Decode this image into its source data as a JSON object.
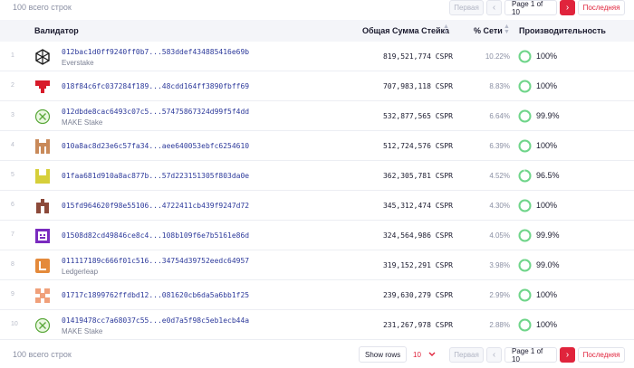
{
  "summary": "100 всего строк",
  "pagination": {
    "first": "Первая",
    "prev": "‹",
    "info": "Page 1 of 10",
    "next": "›",
    "last": "Последняя"
  },
  "footer": {
    "summary": "100 всего строк",
    "show_rows": "Show rows",
    "rows_per_page": "10"
  },
  "table": {
    "columns": {
      "validator": "Валидатор",
      "stake": "Общая Сумма Стейка",
      "share": "% Сети",
      "performance": "Производительность"
    },
    "rows": [
      {
        "index": "1",
        "address": "012bac1d0ff9240ff0b7...583ddef434885416e69b",
        "name": "Everstake",
        "stake": "819,521,774 CSPR",
        "share": "10.22%",
        "performance": "100%",
        "logo": "everstake-icon",
        "perf_value": 1.0
      },
      {
        "index": "2",
        "address": "018f84c6fc037284f189...48cdd164ff3890fbff69",
        "name": "",
        "stake": "707,983,118 CSPR",
        "share": "8.83%",
        "performance": "100%",
        "logo": "pixel-red-icon",
        "perf_value": 1.0
      },
      {
        "index": "3",
        "address": "012dbde8cac6493c07c5...57475867324d99f5f4dd",
        "name": "MAKE Stake",
        "stake": "532,877,565 CSPR",
        "share": "6.64%",
        "performance": "99.9%",
        "logo": "make-stake-icon",
        "perf_value": 0.999
      },
      {
        "index": "4",
        "address": "010a8ac8d23e6c57fa34...aee640053ebfc6254610",
        "name": "",
        "stake": "512,724,576 CSPR",
        "share": "6.39%",
        "performance": "100%",
        "logo": "pixel-tan-icon",
        "perf_value": 1.0
      },
      {
        "index": "5",
        "address": "01faa681d910a8ac877b...57d223151305f803da0e",
        "name": "",
        "stake": "362,305,781 CSPR",
        "share": "4.52%",
        "performance": "96.5%",
        "logo": "pixel-yellow-icon",
        "perf_value": 0.965
      },
      {
        "index": "6",
        "address": "015fd964620f98e55106...4722411cb439f9247d72",
        "name": "",
        "stake": "345,312,474 CSPR",
        "share": "4.30%",
        "performance": "100%",
        "logo": "pixel-brown-icon",
        "perf_value": 1.0
      },
      {
        "index": "7",
        "address": "01508d82cd49846ce8c4...108b109f6e7b5161e86d",
        "name": "",
        "stake": "324,564,986 CSPR",
        "share": "4.05%",
        "performance": "99.9%",
        "logo": "pixel-purple-icon",
        "perf_value": 0.999
      },
      {
        "index": "8",
        "address": "011117189c666f01c516...34754d39752eedc64957",
        "name": "Ledgerleap",
        "stake": "319,152,291 CSPR",
        "share": "3.98%",
        "performance": "99.0%",
        "logo": "ledgerleap-icon",
        "perf_value": 0.99
      },
      {
        "index": "9",
        "address": "01717c1899762ffdbd12...081620cb6da5a6bb1f25",
        "name": "",
        "stake": "239,630,279 CSPR",
        "share": "2.99%",
        "performance": "100%",
        "logo": "pixel-peach-icon",
        "perf_value": 1.0
      },
      {
        "index": "10",
        "address": "01419478cc7a68037c55...e0d7a5f98c5eb1ecb44a",
        "name": "MAKE Stake",
        "stake": "231,267,978 CSPR",
        "share": "2.88%",
        "performance": "100%",
        "logo": "make-stake-icon",
        "perf_value": 1.0
      }
    ]
  },
  "colors": {
    "accent": "#e0243c",
    "address": "#2d3a9b",
    "performance_ring": "#6fd58a",
    "header_bg": "#f4f5f9"
  }
}
